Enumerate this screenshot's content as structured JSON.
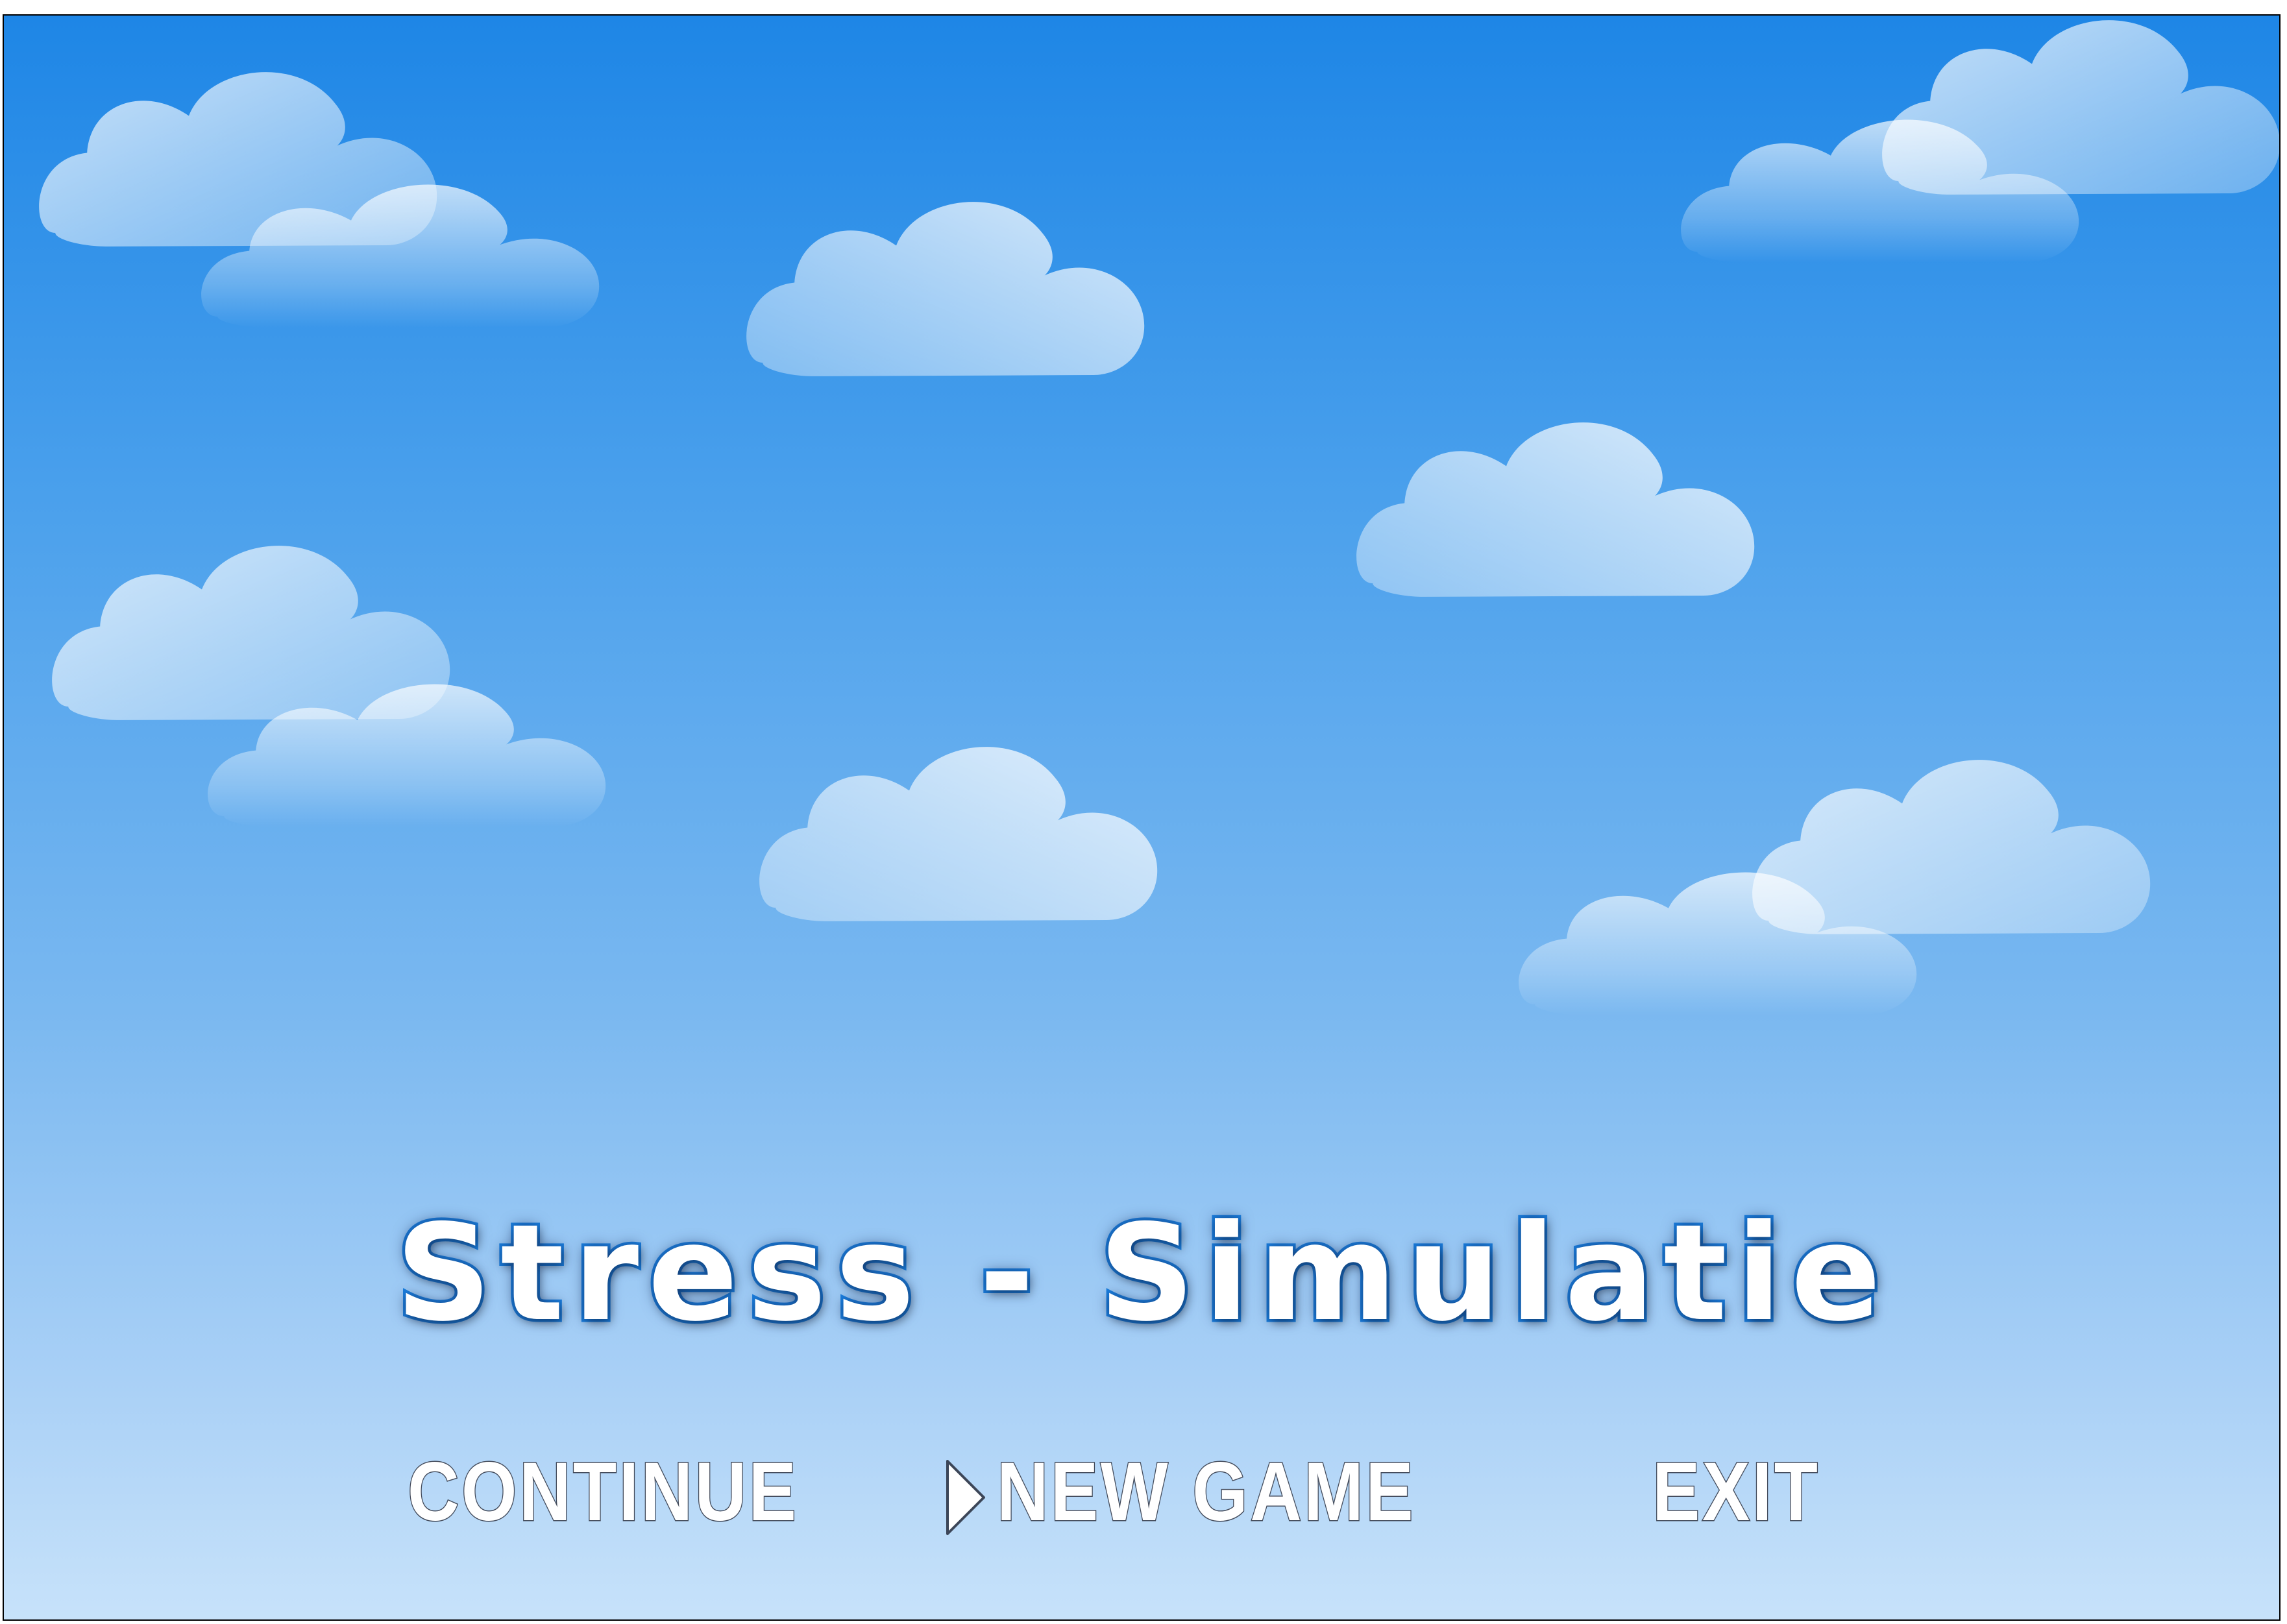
{
  "game": {
    "title": "Stress - Simulatie"
  },
  "menu": {
    "items": [
      {
        "label": "CONTINUE"
      },
      {
        "label": "NEW GAME"
      },
      {
        "label": "EXIT"
      }
    ],
    "selected_item": "NEW GAME"
  },
  "icons": {
    "cursor": "selection-arrow-icon",
    "cloud": "cloud-icon"
  },
  "colors": {
    "sky_top": "#1e86e6",
    "sky_bottom": "#c7e2fa",
    "title_fill": "#ffffff",
    "title_outline": "#1a7fe0",
    "menu_text": "#ffffff"
  }
}
